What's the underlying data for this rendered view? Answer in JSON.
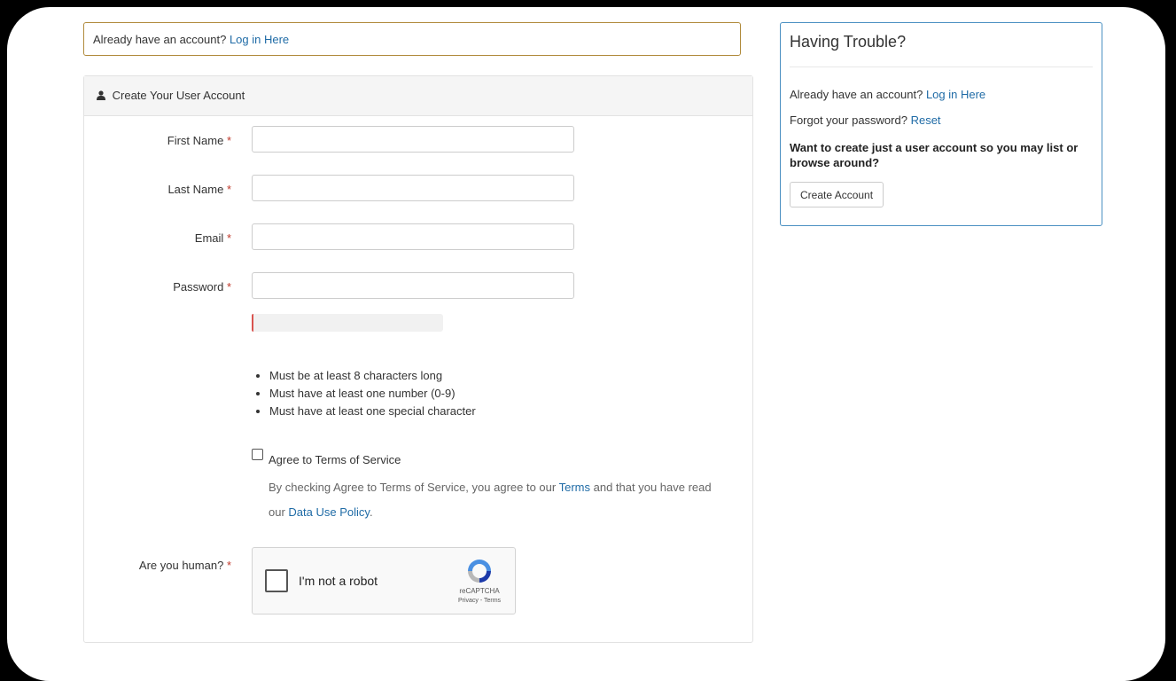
{
  "login_bar": {
    "text": "Already have an account?",
    "link": "Log in Here"
  },
  "panel": {
    "title": "Create Your User Account",
    "fields": [
      {
        "label": "First Name",
        "required": "*"
      },
      {
        "label": "Last Name",
        "required": "*"
      },
      {
        "label": "Email",
        "required": "*"
      },
      {
        "label": "Password",
        "required": "*"
      }
    ],
    "password_strength": 0.01,
    "password_rules": [
      "Must be at least 8 characters long",
      "Must have at least one number (0-9)",
      "Must have at least one special character"
    ],
    "tos": {
      "label": "Agree to Terms of Service",
      "help_prefix": "By checking Agree to Terms of Service, you agree to our",
      "terms_link": "Terms",
      "help_middle": "and that you have read our",
      "policy_link": "Data Use Policy",
      "help_suffix": "."
    },
    "human": {
      "label": "Are you human?",
      "required": "*",
      "captcha_text": "I'm not a robot",
      "captcha_brand": "reCAPTCHA",
      "captcha_links": "Privacy - Terms"
    }
  },
  "sidebar": {
    "title": "Having Trouble?",
    "account_text": "Already have an account?",
    "account_link": "Log in Here",
    "forgot_text": "Forgot your password?",
    "forgot_link": "Reset",
    "create_prompt": "Want to create just a user account so you may list or browse around?",
    "create_button": "Create Account"
  },
  "colors": {
    "link": "#1f6ba6",
    "required": "#c0392b",
    "sidebar_border": "#4a90c2",
    "login_border": "#b08a3b"
  }
}
